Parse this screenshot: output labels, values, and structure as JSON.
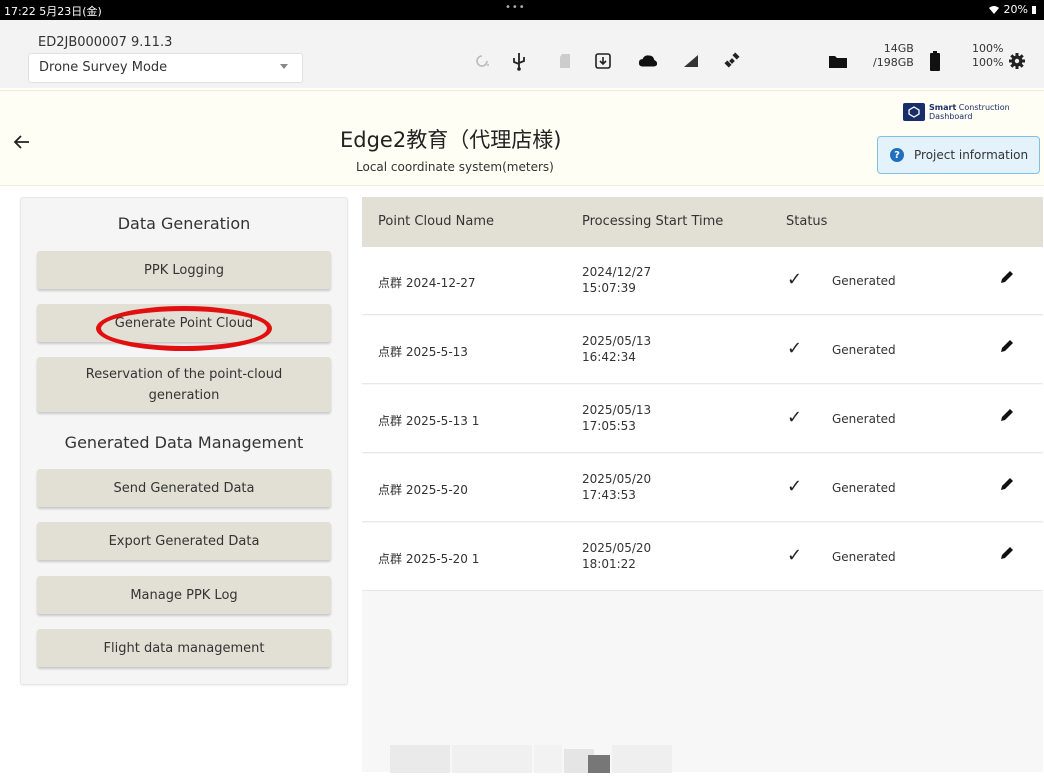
{
  "status_bar": {
    "time_date": "17:22  5月23日(金)",
    "dots": "•••",
    "battery": "20%"
  },
  "toolbar": {
    "device_id": "ED2JB000007   9.11.3",
    "mode": "Drone Survey Mode",
    "storage_used": "14GB",
    "storage_total": "/198GB",
    "percent_1": "100%",
    "percent_2": "100%",
    "icons": [
      "refresh-icon",
      "usb-icon",
      "sd-card-icon",
      "download-icon",
      "cloud-icon",
      "signal-icon",
      "satellite-icon",
      "folder-icon",
      "battery-icon",
      "gear-icon"
    ]
  },
  "project": {
    "title": "Edge2教育（代理店様)",
    "subtitle": "Local coordinate system(meters)",
    "brand_line1_bold": "Smart",
    "brand_line1_rest": " Construction",
    "brand_line2": "Dashboard",
    "info_button": "Project information",
    "info_mark": "?"
  },
  "sidebar": {
    "data_generation_title": "Data Generation",
    "ppk_logging": "PPK Logging",
    "generate_point_cloud": "Generate Point Cloud",
    "reservation": "Reservation of the point-cloud generation",
    "generated_management_title": "Generated Data Management",
    "send_generated": "Send Generated Data",
    "export_generated": "Export Generated Data",
    "manage_ppk": "Manage PPK Log",
    "flight_data": "Flight data management"
  },
  "table": {
    "headers": {
      "name": "Point Cloud Name",
      "time": "Processing Start Time",
      "status": "Status"
    },
    "rows": [
      {
        "name": "点群 2024-12-27",
        "date": "2024/12/27",
        "time": "15:07:39",
        "check": "✓",
        "status": "Generated"
      },
      {
        "name": "点群 2025-5-13",
        "date": "2025/05/13",
        "time": "16:42:34",
        "check": "✓",
        "status": "Generated"
      },
      {
        "name": "点群 2025-5-13 1",
        "date": "2025/05/13",
        "time": "17:05:53",
        "check": "✓",
        "status": "Generated"
      },
      {
        "name": "点群 2025-5-20",
        "date": "2025/05/20",
        "time": "17:43:53",
        "check": "✓",
        "status": "Generated"
      },
      {
        "name": "点群 2025-5-20 1",
        "date": "2025/05/20",
        "time": "18:01:22",
        "check": "✓",
        "status": "Generated"
      }
    ]
  },
  "colors": {
    "accent_red": "#e10f0f",
    "button_bg": "#e2e0d5",
    "info_blue": "#1f6fbf"
  }
}
